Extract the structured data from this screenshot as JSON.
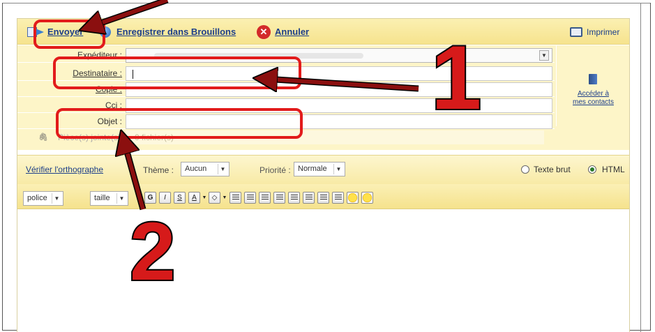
{
  "toolbar": {
    "send_label": "Envoyer",
    "save_draft_label": "Enregistrer dans Brouillons",
    "cancel_label": "Annuler",
    "print_label": "Imprimer"
  },
  "form": {
    "sender_label": "Expéditeur :",
    "to_label": "Destinataire :",
    "cc_label": "Copie :",
    "bcc_label": "Cci :",
    "subject_label": "Objet :",
    "attachments_label": "Pièce(s) jointe(s) :",
    "attachments_count": "0 fichier(s)",
    "contacts_link_line1": "Accéder à",
    "contacts_link_line2": "mes contacts"
  },
  "options": {
    "spellcheck_label": "Vérifier l'orthographe",
    "theme_label": "Thème :",
    "theme_value": "Aucun",
    "priority_label": "Priorité :",
    "priority_value": "Normale",
    "format_plain_label": "Texte brut",
    "format_html_label": "HTML",
    "format_selected": "HTML"
  },
  "editor_toolbar": {
    "font_label": "police",
    "size_label": "taille",
    "bold_glyph": "G",
    "italic_glyph": "I",
    "underline_glyph": "S",
    "font_color_glyph": "A"
  },
  "annotations": {
    "number_1": "1",
    "number_2": "2",
    "color": "#e21b1b"
  }
}
